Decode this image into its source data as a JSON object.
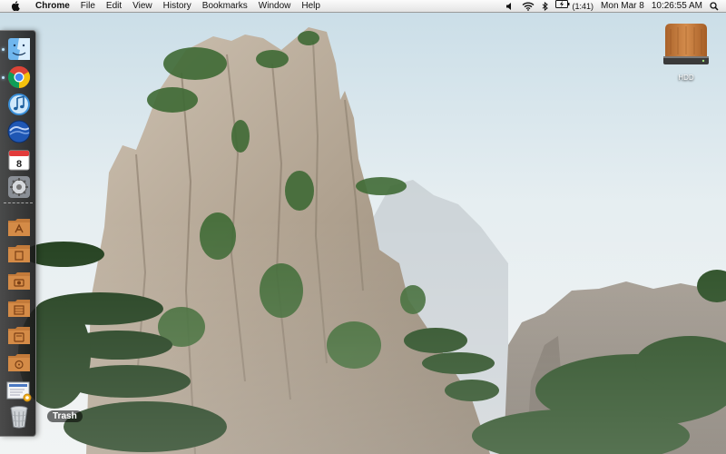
{
  "menubar": {
    "app_name": "Chrome",
    "items": [
      "File",
      "Edit",
      "View",
      "History",
      "Bookmarks",
      "Window",
      "Help"
    ],
    "battery_time": "(1:41)",
    "date": "Mon Mar 8",
    "clock": "10:26:55 AM"
  },
  "desktop": {
    "icons": [
      {
        "label": "HDD",
        "icon": "wooden-drive-icon"
      }
    ]
  },
  "dock": {
    "orientation": "left",
    "trash_tooltip": "Trash",
    "items": [
      {
        "icon": "finder-icon",
        "running": true
      },
      {
        "icon": "chrome-icon",
        "running": true
      },
      {
        "icon": "itunes-icon",
        "running": false
      },
      {
        "icon": "google-earth-icon",
        "running": false
      },
      {
        "icon": "ical-icon",
        "day": "8",
        "running": false
      },
      {
        "icon": "system-preferences-icon",
        "running": false
      },
      {
        "icon": "applications-folder-icon",
        "running": false
      },
      {
        "icon": "documents-folder-icon",
        "running": false
      },
      {
        "icon": "pictures-folder-icon",
        "running": false
      },
      {
        "icon": "movies-folder-icon",
        "running": false
      },
      {
        "icon": "downloads-folder-icon",
        "running": false
      },
      {
        "icon": "music-folder-icon",
        "running": false
      },
      {
        "icon": "preview-document-icon",
        "running": false
      },
      {
        "icon": "trash-icon",
        "running": false
      }
    ]
  },
  "colors": {
    "sky": "#dfeaf0",
    "rock": "#b8aa98",
    "foliage": "#2f5a2c",
    "wood": "#c07a3e"
  }
}
